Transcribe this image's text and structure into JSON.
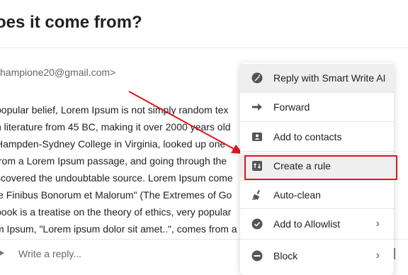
{
  "email": {
    "title": "oes it come from?",
    "sender": "hampione20@gmail.com>",
    "body_lines": [
      "popular belief, Lorem Ipsum is not simply random tex",
      "n literature from 45 BC, making it over 2000 years old",
      " Hampden-Sydney College in Virginia, looked up one",
      " from a Lorem Ipsum passage, and going through the",
      "scovered the undoubtable source. Lorem Ipsum come",
      "le Finibus Bonorum et Malorum\" (The Extremes of Go",
      "book is a treatise on the theory of ethics, very popular",
      "m Ipsum, \"Lorem ipsum dolor sit amet..\", comes from a"
    ]
  },
  "reply": {
    "placeholder": "Write a reply..."
  },
  "menu": {
    "items": [
      {
        "label": "Reply with Smart Write AI",
        "icon": "smart-write-icon"
      },
      {
        "label": "Forward",
        "icon": "forward-icon"
      },
      {
        "label": "Add to contacts",
        "icon": "contact-card-icon"
      },
      {
        "label": "Create a rule",
        "icon": "rule-icon"
      },
      {
        "label": "Auto-clean",
        "icon": "broom-icon"
      },
      {
        "label": "Add to Allowlist",
        "icon": "check-circle-icon",
        "submenu": true
      },
      {
        "label": "Block",
        "icon": "block-icon",
        "submenu": true
      }
    ]
  },
  "annotation": {
    "highlight_color": "#e0151b"
  }
}
